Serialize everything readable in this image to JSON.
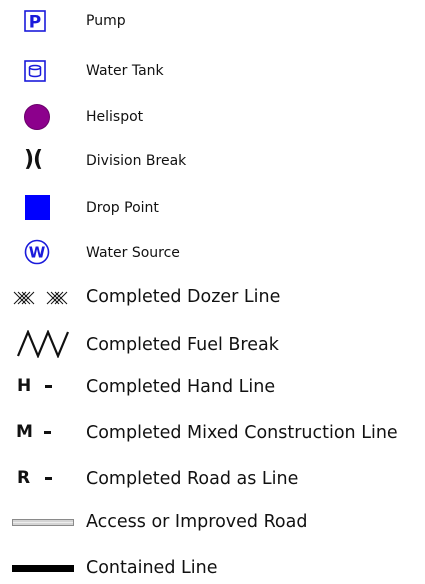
{
  "legend": {
    "items": [
      {
        "icon": "pump-icon",
        "glyph": "P",
        "label": "Pump",
        "color": "#1a1adb"
      },
      {
        "icon": "water-tank-icon",
        "label": "Water Tank",
        "color": "#1a1adb"
      },
      {
        "icon": "helispot-icon",
        "label": "Helispot",
        "color": "#8c008c"
      },
      {
        "icon": "division-break-icon",
        "glyph": ")(",
        "label": "Division Break",
        "color": "#111111"
      },
      {
        "icon": "drop-point-icon",
        "label": "Drop Point",
        "color": "#0000ff"
      },
      {
        "icon": "water-source-icon",
        "glyph": "W",
        "label": "Water Source",
        "color": "#1a1adb"
      },
      {
        "icon": "completed-dozer-line-icon",
        "label": "Completed Dozer Line",
        "color": "#111111"
      },
      {
        "icon": "completed-fuel-break-icon",
        "label": "Completed Fuel Break",
        "color": "#111111"
      },
      {
        "icon": "completed-hand-line-icon",
        "glyph": "H",
        "label": "Completed Hand Line",
        "color": "#111111"
      },
      {
        "icon": "completed-mixed-construction-line-icon",
        "glyph": "M",
        "label": "Completed Mixed Construction Line",
        "color": "#111111"
      },
      {
        "icon": "completed-road-as-line-icon",
        "glyph": "R",
        "label": "Completed Road as Line",
        "color": "#111111"
      },
      {
        "icon": "access-or-improved-road-icon",
        "label": "Access or Improved Road",
        "color": "#9a9a9a"
      },
      {
        "icon": "contained-line-icon",
        "label": "Contained Line",
        "color": "#000000"
      }
    ]
  }
}
